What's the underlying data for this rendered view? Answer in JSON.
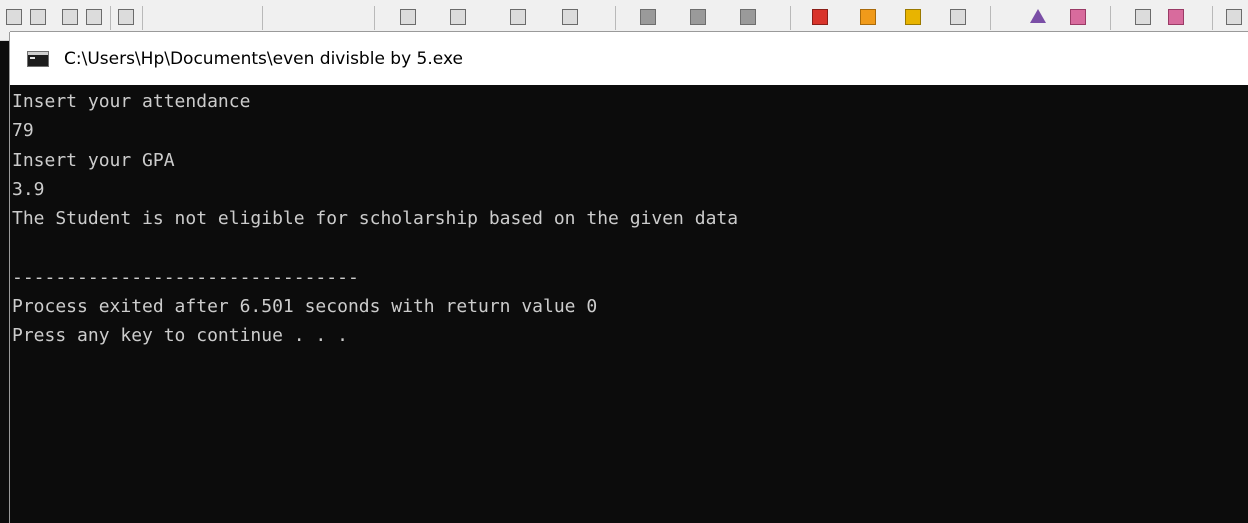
{
  "window": {
    "title": "C:\\Users\\Hp\\Documents\\even divisble by 5.exe"
  },
  "console": {
    "lines": [
      "Insert your attendance",
      "79",
      "Insert your GPA",
      "3.9",
      "The Student is not eligible for scholarship based on the given data",
      "",
      "--------------------------------",
      "Process exited after 6.501 seconds with return value 0",
      "Press any key to continue . . ."
    ]
  },
  "colors": {
    "console_background": "#0c0c0c",
    "console_text": "#cccccc",
    "titlebar_background": "#ffffff"
  }
}
